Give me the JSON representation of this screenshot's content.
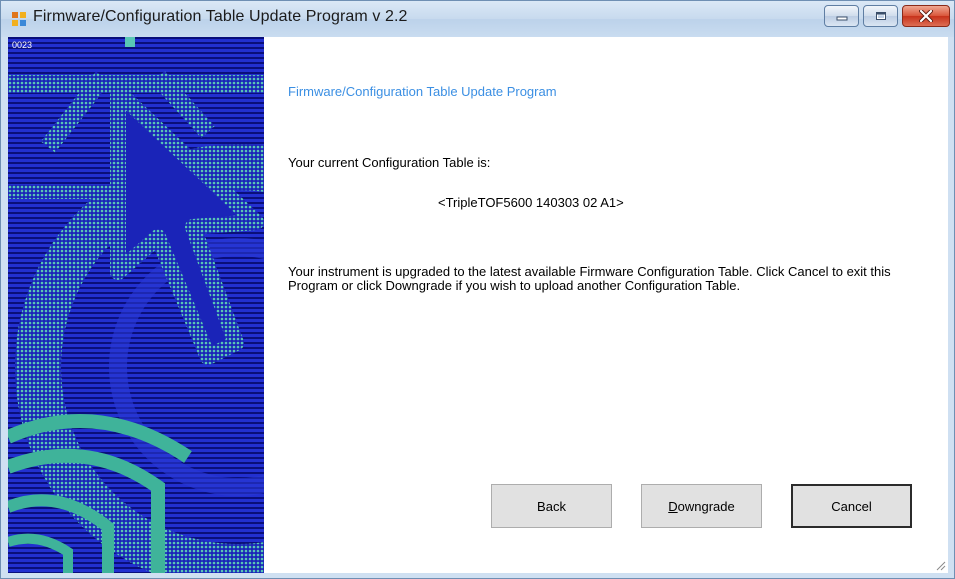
{
  "window": {
    "title": "Firmware/Configuration Table Update Program v 2.2",
    "icons": {
      "app": "app-window-icon",
      "minimize": "minimize-icon",
      "maximize": "maximize-icon",
      "close": "close-icon"
    }
  },
  "side_panel": {
    "corner_label": "0023"
  },
  "content": {
    "heading": "Firmware/Configuration Table Update Program",
    "current_label": "Your current Configuration Table is:",
    "table_value": "<TripleTOF5600 140303 02 A1>",
    "message": "Your instrument is upgraded to the latest available Firmware Configuration Table. Click Cancel to exit this Program or click Downgrade if you wish to upload another Configuration Table."
  },
  "buttons": {
    "back": "Back",
    "downgrade_mnemonic": "D",
    "downgrade_rest": "owngrade",
    "cancel": "Cancel"
  },
  "colors": {
    "heading": "#3b8fe3",
    "panel_blue": "#1a24b8",
    "panel_teal": "#4bb8a8",
    "close_red": "#c7321b"
  }
}
